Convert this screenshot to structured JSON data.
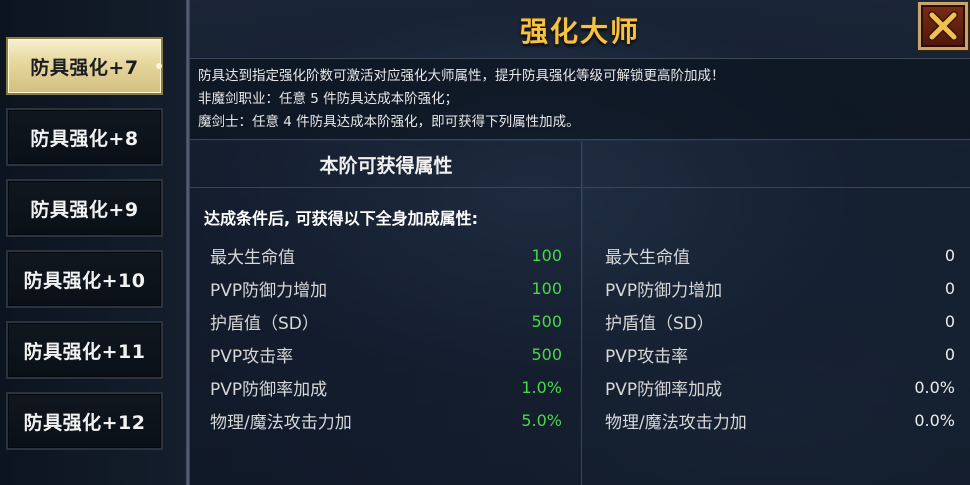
{
  "title": "强化大师",
  "tabs": [
    {
      "label": "防具强化+7",
      "active": true
    },
    {
      "label": "防具强化+8",
      "active": false
    },
    {
      "label": "防具强化+9",
      "active": false
    },
    {
      "label": "防具强化+10",
      "active": false
    },
    {
      "label": "防具强化+11",
      "active": false
    },
    {
      "label": "防具强化+12",
      "active": false
    }
  ],
  "description": {
    "line1": "防具达到指定强化阶数可激活对应强化大师属性，提升防具强化等级可解锁更高阶加成！",
    "line2": "非魔剑职业：任意 5 件防具达成本阶强化；",
    "line3": "魔剑士：任意 4 件防具达成本阶强化，即可获得下列属性加成。"
  },
  "left_panel": {
    "header": "本阶可获得属性",
    "condition": "达成条件后, 可获得以下全身加成属性:",
    "stats": [
      {
        "name": "最大生命值",
        "value": "100"
      },
      {
        "name": "PVP防御力增加",
        "value": "100"
      },
      {
        "name": "护盾值（SD）",
        "value": "500"
      },
      {
        "name": "PVP攻击率",
        "value": "500"
      },
      {
        "name": "PVP防御率加成",
        "value": "1.0%"
      },
      {
        "name": "物理/魔法攻击力加",
        "value": "5.0%"
      }
    ]
  },
  "right_panel": {
    "header": "",
    "stats": [
      {
        "name": "最大生命值",
        "value": "0"
      },
      {
        "name": "PVP防御力增加",
        "value": "0"
      },
      {
        "name": "护盾值（SD）",
        "value": "0"
      },
      {
        "name": "PVP攻击率",
        "value": "0"
      },
      {
        "name": "PVP防御率加成",
        "value": "0.0%"
      },
      {
        "name": "物理/魔法攻击力加",
        "value": "0.0%"
      }
    ]
  },
  "colors": {
    "title_gold": "#f5c245",
    "value_green": "#48d848",
    "value_white": "#ececec"
  },
  "icons": {
    "close": "close-x-icon"
  }
}
